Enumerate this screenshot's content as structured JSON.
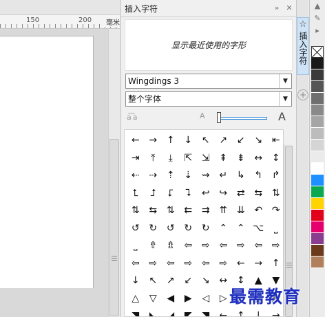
{
  "ruler": {
    "labels": [
      "150",
      "200"
    ],
    "unit": "毫米"
  },
  "docker": {
    "title": "插入字符",
    "preview_text": "显示最近使用的字形",
    "font_select": "Wingdings 3",
    "subset_select": "整个字体",
    "vertical_tab": "插入字符"
  },
  "glyphs": [
    "←",
    "→",
    "↑",
    "↓",
    "↖",
    "↗",
    "↙",
    "↘",
    "⇤",
    "⇥",
    "⤒",
    "⤓",
    "⇱",
    "⇲",
    "⇞",
    "⇟",
    "↔",
    "↕",
    "⇠",
    "⇢",
    "⇡",
    "⇣",
    "⇝",
    "↵",
    "↳",
    "↰",
    "↱",
    "⮤",
    "⮥",
    "⮦",
    "⮧",
    "↩",
    "↪",
    "⇄",
    "⇆",
    "⇅",
    "⇅",
    "⇆",
    "⇅",
    "⇇",
    "⇉",
    "⇈",
    "⇊",
    "↶",
    "↷",
    "↺",
    "↻",
    "↺",
    "↻",
    "↻",
    "⌃",
    "⌃",
    "⌥",
    "⎵",
    "⎵",
    "⇮",
    "⇯",
    "⇦",
    "⇨",
    "⇦",
    "⇨",
    "⇦",
    "⇨",
    "⇦",
    "⇨",
    "⇦",
    "⇨",
    "⇦",
    "⇨",
    "←",
    "→",
    "↑",
    "↓",
    "↖",
    "↗",
    "↙",
    "↘",
    "↔",
    "↕",
    "▲",
    "▼",
    "△",
    "▽",
    "◀",
    "▶",
    "◁",
    "▷",
    "◣",
    "◢",
    "◤",
    "◥",
    "◣",
    "◢",
    "◤",
    "◥",
    "←",
    "↑",
    "↓",
    "→"
  ],
  "palette": {
    "colors": [
      "#1a1a1a",
      "#3a3a3a",
      "#555555",
      "#6f6f6f",
      "#8a8a8a",
      "#a5a5a5",
      "#bcbcbc",
      "#d5d5d5",
      "#ebebeb",
      "#ffffff",
      "#1e90ff",
      "#0aa84f",
      "#ffd400",
      "#e3001b",
      "#e6006e",
      "#8a3d8f",
      "#6b3a1a",
      "#b0805c"
    ]
  },
  "watermark": "最需教育"
}
